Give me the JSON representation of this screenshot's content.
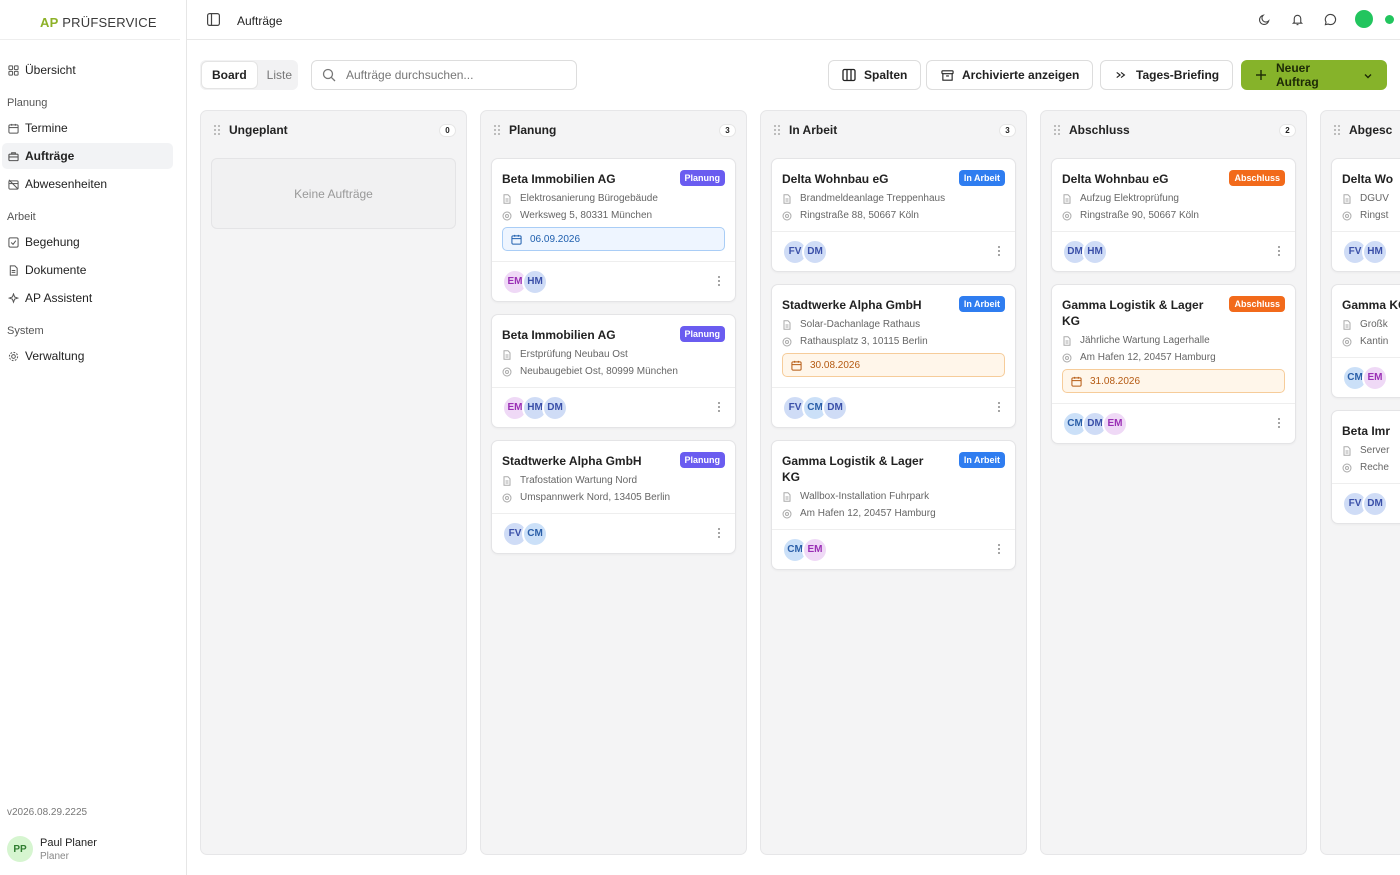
{
  "app": {
    "logo_ap": "AP",
    "logo_rest": " PRÜFSERVICE",
    "version": "v2026.08.29.2225"
  },
  "sidebar": {
    "items_top": [
      {
        "label": "Übersicht",
        "icon": "grid-icon"
      }
    ],
    "sections": [
      {
        "title": "Planung",
        "items": [
          {
            "label": "Termine",
            "icon": "calendar-icon"
          },
          {
            "label": "Aufträge",
            "icon": "briefcase-icon",
            "active": true
          },
          {
            "label": "Abwesenheiten",
            "icon": "calendar-off-icon"
          }
        ]
      },
      {
        "title": "Arbeit",
        "items": [
          {
            "label": "Begehung",
            "icon": "checkbox-icon"
          },
          {
            "label": "Dokumente",
            "icon": "document-icon"
          },
          {
            "label": "AP Assistent",
            "icon": "sparkle-icon"
          }
        ]
      },
      {
        "title": "System",
        "items": [
          {
            "label": "Verwaltung",
            "icon": "gear-icon"
          }
        ]
      }
    ],
    "user": {
      "initials": "PP",
      "name": "Paul Planer",
      "role": "Planer"
    }
  },
  "topbar": {
    "title": "Aufträge"
  },
  "toolbar": {
    "view_board": "Board",
    "view_list": "Liste",
    "search_placeholder": "Aufträge durchsuchen...",
    "columns_label": "Spalten",
    "archived_label": "Archivierte anzeigen",
    "briefing_label": "Tages-Briefing",
    "new_label": "Neuer Auftrag"
  },
  "colors": {
    "accent": "#86b32a",
    "planung": "#6a5cf0",
    "arbeit": "#2f7df0",
    "abschluss": "#f26a1b"
  },
  "board": {
    "columns": [
      {
        "title": "Ungeplant",
        "count": "0",
        "empty_text": "Keine Aufträge",
        "cards": []
      },
      {
        "title": "Planung",
        "count": "3",
        "cards": [
          {
            "client": "Beta Immobilien AG",
            "badge": "Planung",
            "kind": "planung",
            "task": "Elektrosanierung Bürogebäude",
            "address": "Werksweg 5, 80331 München",
            "date": "06.09.2026",
            "date_style": "blue",
            "avatars": [
              {
                "i": "EM",
                "c": "purple"
              },
              {
                "i": "HM",
                "c": "blue"
              }
            ]
          },
          {
            "client": "Beta Immobilien AG",
            "badge": "Planung",
            "kind": "planung",
            "task": "Erstprüfung Neubau Ost",
            "address": "Neubaugebiet Ost, 80999 München",
            "avatars": [
              {
                "i": "EM",
                "c": "purple"
              },
              {
                "i": "HM",
                "c": "blue"
              },
              {
                "i": "DM",
                "c": "blue"
              }
            ]
          },
          {
            "client": "Stadtwerke Alpha GmbH",
            "badge": "Planung",
            "kind": "planung",
            "task": "Trafostation Wartung Nord",
            "address": "Umspannwerk Nord, 13405 Berlin",
            "avatars": [
              {
                "i": "FV",
                "c": "blue"
              },
              {
                "i": "CM",
                "c": "lblue"
              }
            ]
          }
        ]
      },
      {
        "title": "In Arbeit",
        "count": "3",
        "cards": [
          {
            "client": "Delta Wohnbau eG",
            "badge": "In Arbeit",
            "kind": "arbeit",
            "task": "Brandmeldeanlage Treppenhaus",
            "address": "Ringstraße 88, 50667 Köln",
            "avatars": [
              {
                "i": "FV",
                "c": "blue"
              },
              {
                "i": "DM",
                "c": "blue"
              }
            ]
          },
          {
            "client": "Stadtwerke Alpha GmbH",
            "badge": "In Arbeit",
            "kind": "arbeit",
            "task": "Solar-Dachanlage Rathaus",
            "address": "Rathausplatz 3, 10115 Berlin",
            "date": "30.08.2026",
            "date_style": "orange",
            "avatars": [
              {
                "i": "FV",
                "c": "blue"
              },
              {
                "i": "CM",
                "c": "lblue"
              },
              {
                "i": "DM",
                "c": "blue"
              }
            ]
          },
          {
            "client": "Gamma Logistik & Lager KG",
            "badge": "In Arbeit",
            "kind": "arbeit",
            "task": "Wallbox-Installation Fuhrpark",
            "address": "Am Hafen 12, 20457 Hamburg",
            "avatars": [
              {
                "i": "CM",
                "c": "lblue"
              },
              {
                "i": "EM",
                "c": "purple"
              }
            ]
          }
        ]
      },
      {
        "title": "Abschluss",
        "count": "2",
        "cards": [
          {
            "client": "Delta Wohnbau eG",
            "badge": "Abschluss",
            "kind": "abschluss",
            "task": "Aufzug Elektroprüfung",
            "address": "Ringstraße 90, 50667 Köln",
            "avatars": [
              {
                "i": "DM",
                "c": "blue"
              },
              {
                "i": "HM",
                "c": "blue"
              }
            ]
          },
          {
            "client": "Gamma Logistik & Lager KG",
            "badge": "Abschluss",
            "kind": "abschluss",
            "task": "Jährliche Wartung Lagerhalle",
            "address": "Am Hafen 12, 20457 Hamburg",
            "date": "31.08.2026",
            "date_style": "orange",
            "avatars": [
              {
                "i": "CM",
                "c": "lblue"
              },
              {
                "i": "DM",
                "c": "blue"
              },
              {
                "i": "EM",
                "c": "purple"
              }
            ]
          }
        ]
      },
      {
        "title": "Abgesc",
        "count": "",
        "cards": [
          {
            "client": "Delta Wo",
            "badge": "",
            "kind": "",
            "task": "DGUV",
            "address": "Ringst",
            "avatars": [
              {
                "i": "FV",
                "c": "blue"
              },
              {
                "i": "HM",
                "c": "blue"
              }
            ]
          },
          {
            "client": "Gamma KG",
            "badge": "",
            "kind": "",
            "task": "Großk",
            "address": "Kantin",
            "avatars": [
              {
                "i": "CM",
                "c": "lblue"
              },
              {
                "i": "EM",
                "c": "purple"
              }
            ]
          },
          {
            "client": "Beta Imr",
            "badge": "",
            "kind": "",
            "task": "Server",
            "address": "Reche",
            "avatars": [
              {
                "i": "FV",
                "c": "blue"
              },
              {
                "i": "DM",
                "c": "blue"
              }
            ]
          }
        ]
      }
    ]
  }
}
